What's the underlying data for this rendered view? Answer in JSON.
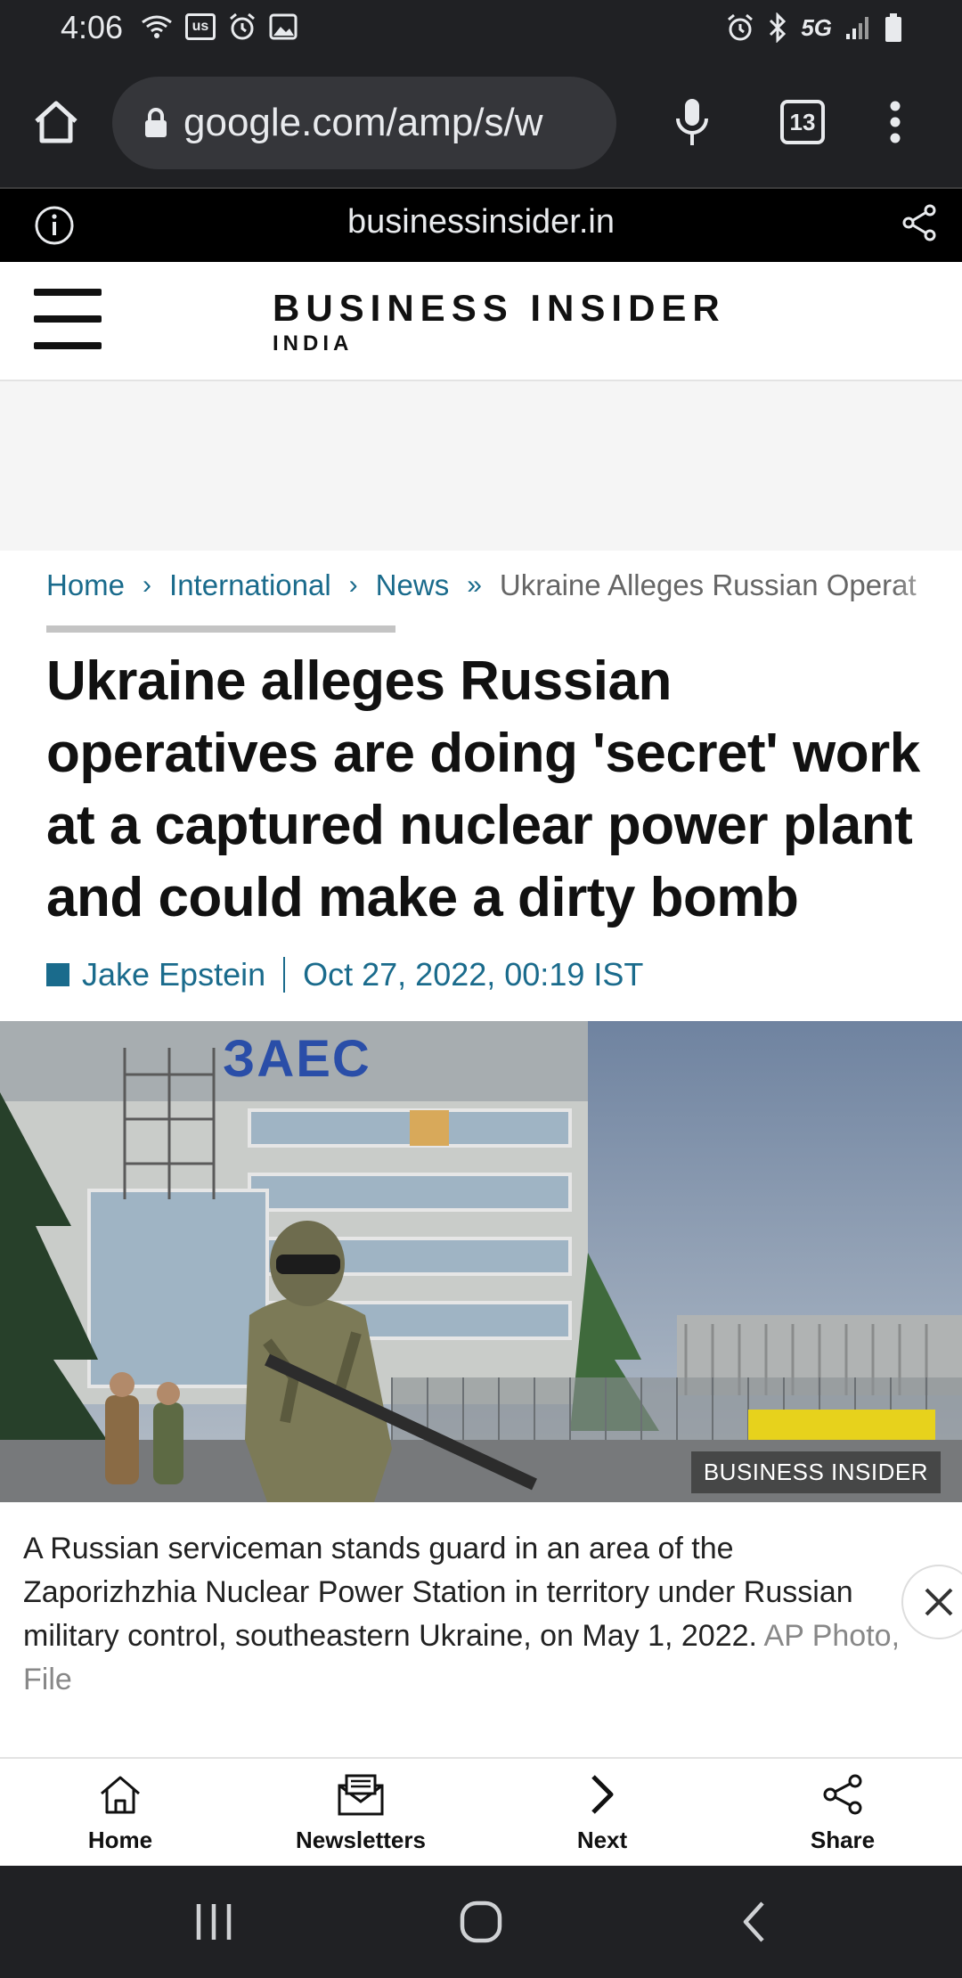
{
  "status_bar": {
    "time": "4:06",
    "left_icons": [
      "wifi-calling-icon",
      "us-badge-icon",
      "alarm-icon",
      "image-icon"
    ],
    "right_icons": [
      "alarm-icon",
      "bluetooth-icon",
      "network-type-icon",
      "signal-icon",
      "battery-icon"
    ],
    "network_label": "5G",
    "us_badge": "us"
  },
  "browser": {
    "url": "google.com/amp/s/w",
    "tab_count": "13"
  },
  "amp_header": {
    "domain": "businessinsider.in"
  },
  "site": {
    "logo_main": "BUSINESS INSIDER",
    "logo_sub": "INDIA"
  },
  "breadcrumb": {
    "items": [
      "Home",
      "International",
      "News"
    ],
    "separators": [
      "›",
      "›",
      "»"
    ],
    "current": "Ukraine Alleges Russian Operat"
  },
  "article": {
    "headline": "Ukraine alleges Russian operatives are doing 'secret' work at a captured nuclear power plant and could make a dirty bomb",
    "author": "Jake Epstein",
    "date": "Oct 27, 2022, 00:19 IST",
    "photo_sign": "ЗАЕС",
    "photo_credit": "BUSINESS INSIDER",
    "caption": "A Russian serviceman stands guard in an area of the Zaporizhzhia Nuclear Power Station in territory under Russian military control, southeastern Ukraine, on May 1, 2022.",
    "caption_credit": "AP Photo, File"
  },
  "bottom_nav": [
    {
      "label": "Home",
      "icon": "home-icon"
    },
    {
      "label": "Newsletters",
      "icon": "newsletter-icon"
    },
    {
      "label": "Next",
      "icon": "chevron-right-icon"
    },
    {
      "label": "Share",
      "icon": "share-icon"
    }
  ],
  "colors": {
    "link": "#1a6b8c",
    "chrome_dark": "#202124"
  }
}
